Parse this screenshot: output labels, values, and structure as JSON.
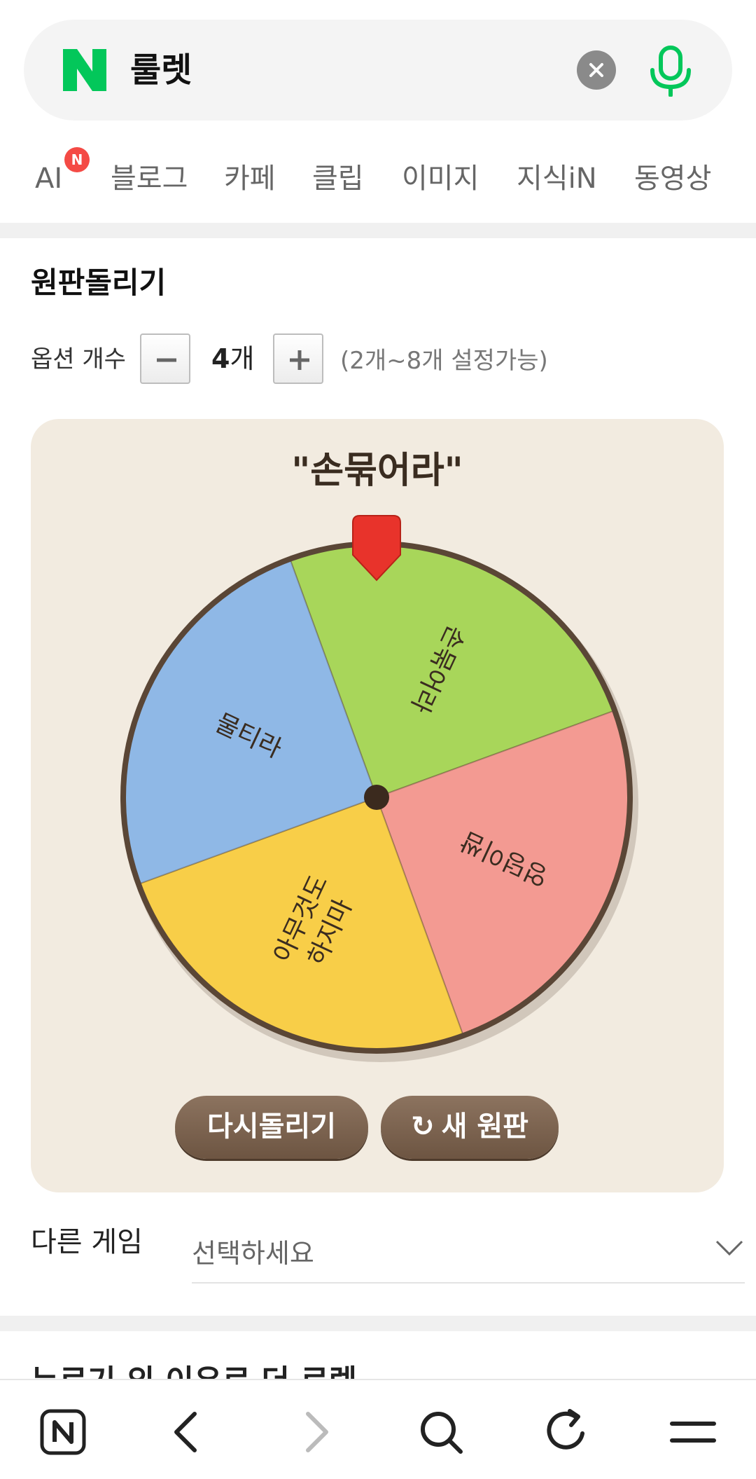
{
  "search": {
    "brand": "N",
    "query": "룰렛",
    "clear_icon": "close-icon",
    "mic_icon": "mic-icon",
    "brand_color": "#03c75a"
  },
  "tabs": [
    {
      "label": "AI",
      "badge": "N"
    },
    {
      "label": "블로그"
    },
    {
      "label": "카페"
    },
    {
      "label": "클립"
    },
    {
      "label": "이미지"
    },
    {
      "label": "지식iN"
    },
    {
      "label": "동영상"
    }
  ],
  "roulette": {
    "title": "원판돌리기",
    "option_label": "옵션 개수",
    "count_value": "4",
    "count_unit": "개",
    "range_hint": "(2개~8개 설정가능)",
    "result": "\"손묶어라\"",
    "segments": [
      {
        "label": "손묶어라",
        "color": "#a8d65a"
      },
      {
        "label": "엉덩이쌈",
        "color": "#f39a92"
      },
      {
        "label": "아무것도 하지마",
        "color": "#f8ce48"
      },
      {
        "label": "물티라",
        "color": "#8fb8e6"
      }
    ],
    "spin_again": "다시돌리기",
    "new_wheel": "새 원판"
  },
  "other_game": {
    "label": "다른 게임",
    "select_placeholder": "선택하세요"
  },
  "next_section_heading": "누르기 외 이유로 더 로렛",
  "bottom_nav": {
    "items": [
      "naver-home-icon",
      "back-icon",
      "forward-icon",
      "search-icon",
      "refresh-icon",
      "menu-icon"
    ]
  }
}
